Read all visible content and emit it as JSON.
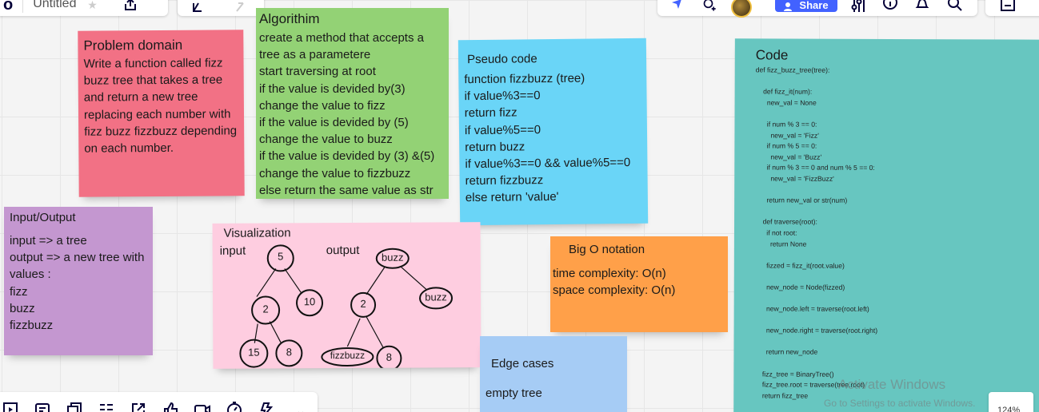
{
  "toolbar": {
    "logo": "o",
    "board_title": "Untitled",
    "share_label": "Share"
  },
  "zoom": "124%",
  "stickies": {
    "problem": {
      "title": "Problem domain",
      "body": "Write a function called fizz buzz tree that takes a tree and return a new tree replacing each number with fizz buzz fizzbuzz depending on each number."
    },
    "algorithm": {
      "title": "Algorithim",
      "lines": [
        "create a method that accepts a",
        "tree as a parametere",
        "start traversing at root",
        "if the  value is devided by(3)",
        "change the value to fizz",
        "if the  value is devided by (5)",
        "change the value to buzz",
        "if the value is devided by (3) &(5)",
        "change the value to fizzbuzz",
        "else return the same value as str"
      ]
    },
    "pseudo": {
      "title": "Pseudo code",
      "lines": [
        "function fizzbuzz (tree)",
        "if value%3==0",
        "return fizz",
        "if value%5==0",
        "return buzz",
        "if value%3==0 && value%5==0",
        "return fizzbuzz",
        "else return 'value'"
      ]
    },
    "code": {
      "title": "Code",
      "source": "def fizz_buzz_tree(tree):\n\n    def fizz_it(num):\n      new_val = None\n\n      if num % 3 == 0:\n        new_val = 'Fizz'\n      if num % 5 == 0:\n        new_val = 'Buzz'\n      if num % 3 == 0 and num % 5 == 0:\n        new_val = 'FizzBuzz'\n\n      return new_val or str(num)\n\n    def traverse(root):\n      if not root:\n        return None\n\n      fizzed = fizz_it(root.value)\n\n      new_node = Node(fizzed)\n\n      new_node.left = traverse(root.left)\n\n      new_node.right = traverse(root.right)\n\n      return new_node\n\n    fizz_tree = BinaryTree()\n    fizz_tree.root = traverse(tree.root)\n    return fizz_tree"
    },
    "io": {
      "title": "Input/Output",
      "lines": [
        "input => a tree",
        "output => a new tree with",
        "values :",
        "fizz",
        "buzz",
        "fizzbuzz"
      ]
    },
    "visualization": {
      "title": "Visualization",
      "input_label": "input",
      "output_label": "output",
      "input_nodes": [
        "5",
        "2",
        "10",
        "15",
        "8"
      ],
      "output_nodes": [
        "buzz",
        "2",
        "buzz",
        "fizzbuzz",
        "8"
      ]
    },
    "bigo": {
      "title": "Big O notation",
      "lines": [
        "time complexity: O(n)",
        "space complexity: O(n)"
      ]
    },
    "edge": {
      "title": "Edge cases",
      "lines": [
        "empty tree"
      ]
    }
  },
  "watermark": {
    "line1": "Activate Windows",
    "line2": "Go to Settings to activate Windows."
  },
  "colors": {
    "problem": "#f27185",
    "algorithm": "#93d275",
    "pseudo": "#6ad5f7",
    "code": "#67c6c0",
    "io": "#c497d0",
    "visualization": "#fecde0",
    "bigo": "#ffa049",
    "edge": "#a6ccf5",
    "share": "#4262ff"
  }
}
